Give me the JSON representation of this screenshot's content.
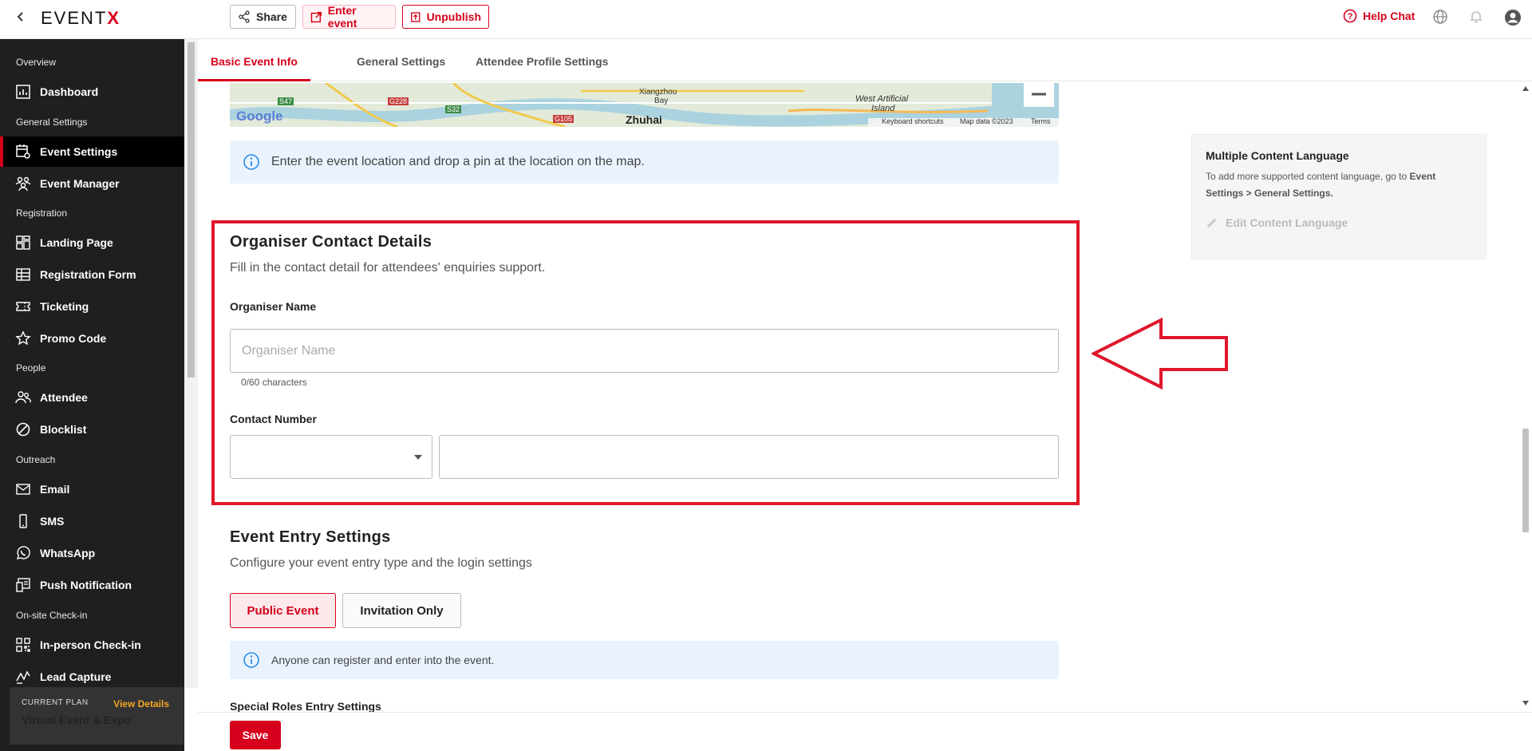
{
  "topbar": {
    "logo_prefix": "EVENT",
    "logo_suffix": "X",
    "share_label": "Share",
    "enter_event_label": "Enter event",
    "unpublish_label": "Unpublish",
    "help_label": "Help Chat"
  },
  "sidebar": {
    "groups": {
      "overview": "Overview",
      "general": "General Settings",
      "registration": "Registration",
      "people": "People",
      "outreach": "Outreach",
      "onsite": "On-site Check-in"
    },
    "items": {
      "dashboard": "Dashboard",
      "event_settings": "Event Settings",
      "event_manager": "Event Manager",
      "landing_page": "Landing Page",
      "registration_form": "Registration Form",
      "ticketing": "Ticketing",
      "promo_code": "Promo Code",
      "attendee": "Attendee",
      "blocklist": "Blocklist",
      "email": "Email",
      "sms": "SMS",
      "whatsapp": "WhatsApp",
      "push_notification": "Push Notification",
      "inperson_checkin": "In-person Check-in",
      "lead_capture": "Lead Capture"
    },
    "plan": {
      "label": "CURRENT PLAN",
      "view_details": "View Details",
      "name": "Virtual Event & Expo"
    }
  },
  "tabs": {
    "basic": "Basic Event Info",
    "general": "General Settings",
    "attendee": "Attendee Profile Settings"
  },
  "map": {
    "google": "Google",
    "labels": {
      "xiangzhou": "Xiangzhou",
      "bay": "Bay",
      "zhuhai": "Zhuhai",
      "west_artificial": "West Artificial",
      "island": "Island",
      "s47": "S47",
      "g228": "G228",
      "s32": "S32",
      "g105": "G105"
    },
    "keyboard_shortcuts": "Keyboard shortcuts",
    "map_data": "Map data ©2023",
    "terms": "Terms"
  },
  "location_info": "Enter the event location and drop a pin at the location on the map.",
  "organiser": {
    "title": "Organiser Contact Details",
    "subtitle": "Fill in the contact detail for attendees' enquiries support.",
    "name_label": "Organiser Name",
    "name_placeholder": "Organiser Name",
    "char_count": "0/60 characters",
    "contact_label": "Contact Number",
    "country_code_value": "",
    "phone_value": ""
  },
  "entry": {
    "title": "Event Entry Settings",
    "subtitle": "Configure your event entry type and the login settings",
    "public_label": "Public Event",
    "invitation_label": "Invitation Only",
    "info": "Anyone can register and enter into the event.",
    "special_roles": "Special Roles Entry Settings"
  },
  "side_card": {
    "title": "Multiple Content Language",
    "desc_prefix": "To add more supported content language, go to ",
    "desc_bold": "Event Settings > General Settings.",
    "edit_label": "Edit Content Language"
  },
  "footer": {
    "save_label": "Save"
  },
  "colors": {
    "accent": "#d6001c",
    "sidebar_bg": "#1f1f1f",
    "info_bg": "#eaf3fd",
    "annotation": "#e0162b"
  }
}
